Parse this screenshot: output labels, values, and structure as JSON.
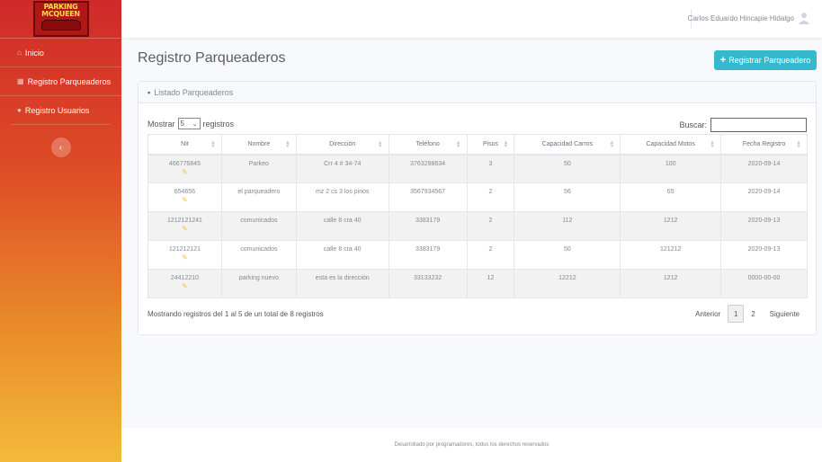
{
  "logo": {
    "line1": "PARKING",
    "line2": "MCQUEEN"
  },
  "sidebar": {
    "items": [
      {
        "label": "Inicio",
        "icon": "home-icon"
      },
      {
        "label": "Registro Parqueaderos",
        "icon": "table-icon"
      },
      {
        "label": "Registro Usuarios",
        "icon": "user-icon"
      }
    ],
    "collapse_icon": "chevron-left-icon"
  },
  "topbar": {
    "user_name": "Carlos Eduardo Hincapie Hidalgo"
  },
  "page": {
    "title": "Registro Parqueaderos",
    "register_button": "Registrar Parqueadero"
  },
  "card": {
    "title": "Listado Parqueaderos"
  },
  "controls": {
    "show_label": "Mostrar",
    "show_value": "5",
    "records_label": "registros",
    "search_label": "Buscar:"
  },
  "table": {
    "headers": [
      "Nit",
      "Nombre",
      "Dirección",
      "Teléfono",
      "Pisos",
      "Capacidad Carros",
      "Capacidad Motos",
      "Fecha Registro"
    ],
    "rows": [
      [
        "466776845",
        "Parkeo",
        "Crr 4 # 34-74",
        "3763298634",
        "3",
        "50",
        "100",
        "2020-09-14"
      ],
      [
        "654656",
        "el parqueadero",
        "mz 2 cs 3 los pinos",
        "3567934567",
        "2",
        "56",
        "65",
        "2020-09-14"
      ],
      [
        "1212121241",
        "comunicados",
        "calle 8 cra 40",
        "3383179",
        "2",
        "112",
        "1212",
        "2020-09-13"
      ],
      [
        "121212121",
        "comunicados",
        "calle 8 cra 40",
        "3383179",
        "2",
        "50",
        "121212",
        "2020-09-13"
      ],
      [
        "24412210",
        "parking nuevo",
        "esta es la dirección",
        "33133232",
        "12",
        "12212",
        "1212",
        "0000-00-00"
      ]
    ]
  },
  "info": "Mostrando registros del 1 al 5 de un total de 8 registros",
  "pagination": {
    "prev": "Anterior",
    "pages": [
      "1",
      "2"
    ],
    "active": "1",
    "next": "Siguiente"
  },
  "footer": "Desarrollado por programadores, todos los derechos reservados",
  "colors": {
    "accent": "#36b9cc",
    "sidebar_top": "#cf2a2a",
    "sidebar_bottom": "#f3b93a",
    "edit": "#f6c23e"
  }
}
